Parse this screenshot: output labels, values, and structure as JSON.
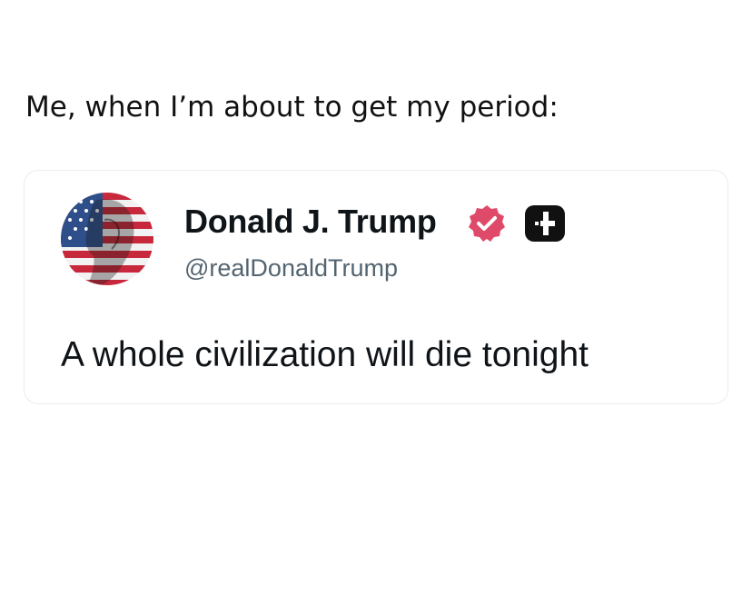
{
  "caption": "Me, when I’m about to get my period:",
  "post": {
    "display_name": "Donald J. Trump",
    "handle": "@realDonaldTrump",
    "text": "A whole civilization will die tonight",
    "avatar_icon": "flag-portrait-avatar",
    "verified_icon": "verified-badge-icon",
    "affiliate_icon": "affiliate-plus-icon"
  },
  "colors": {
    "verified_badge": "#e04a6a",
    "affiliate_badge": "#111111",
    "handle_text": "#536471",
    "card_border": "#ececec",
    "flag_red": "#c8283b",
    "flag_blue": "#2e4f8a"
  }
}
